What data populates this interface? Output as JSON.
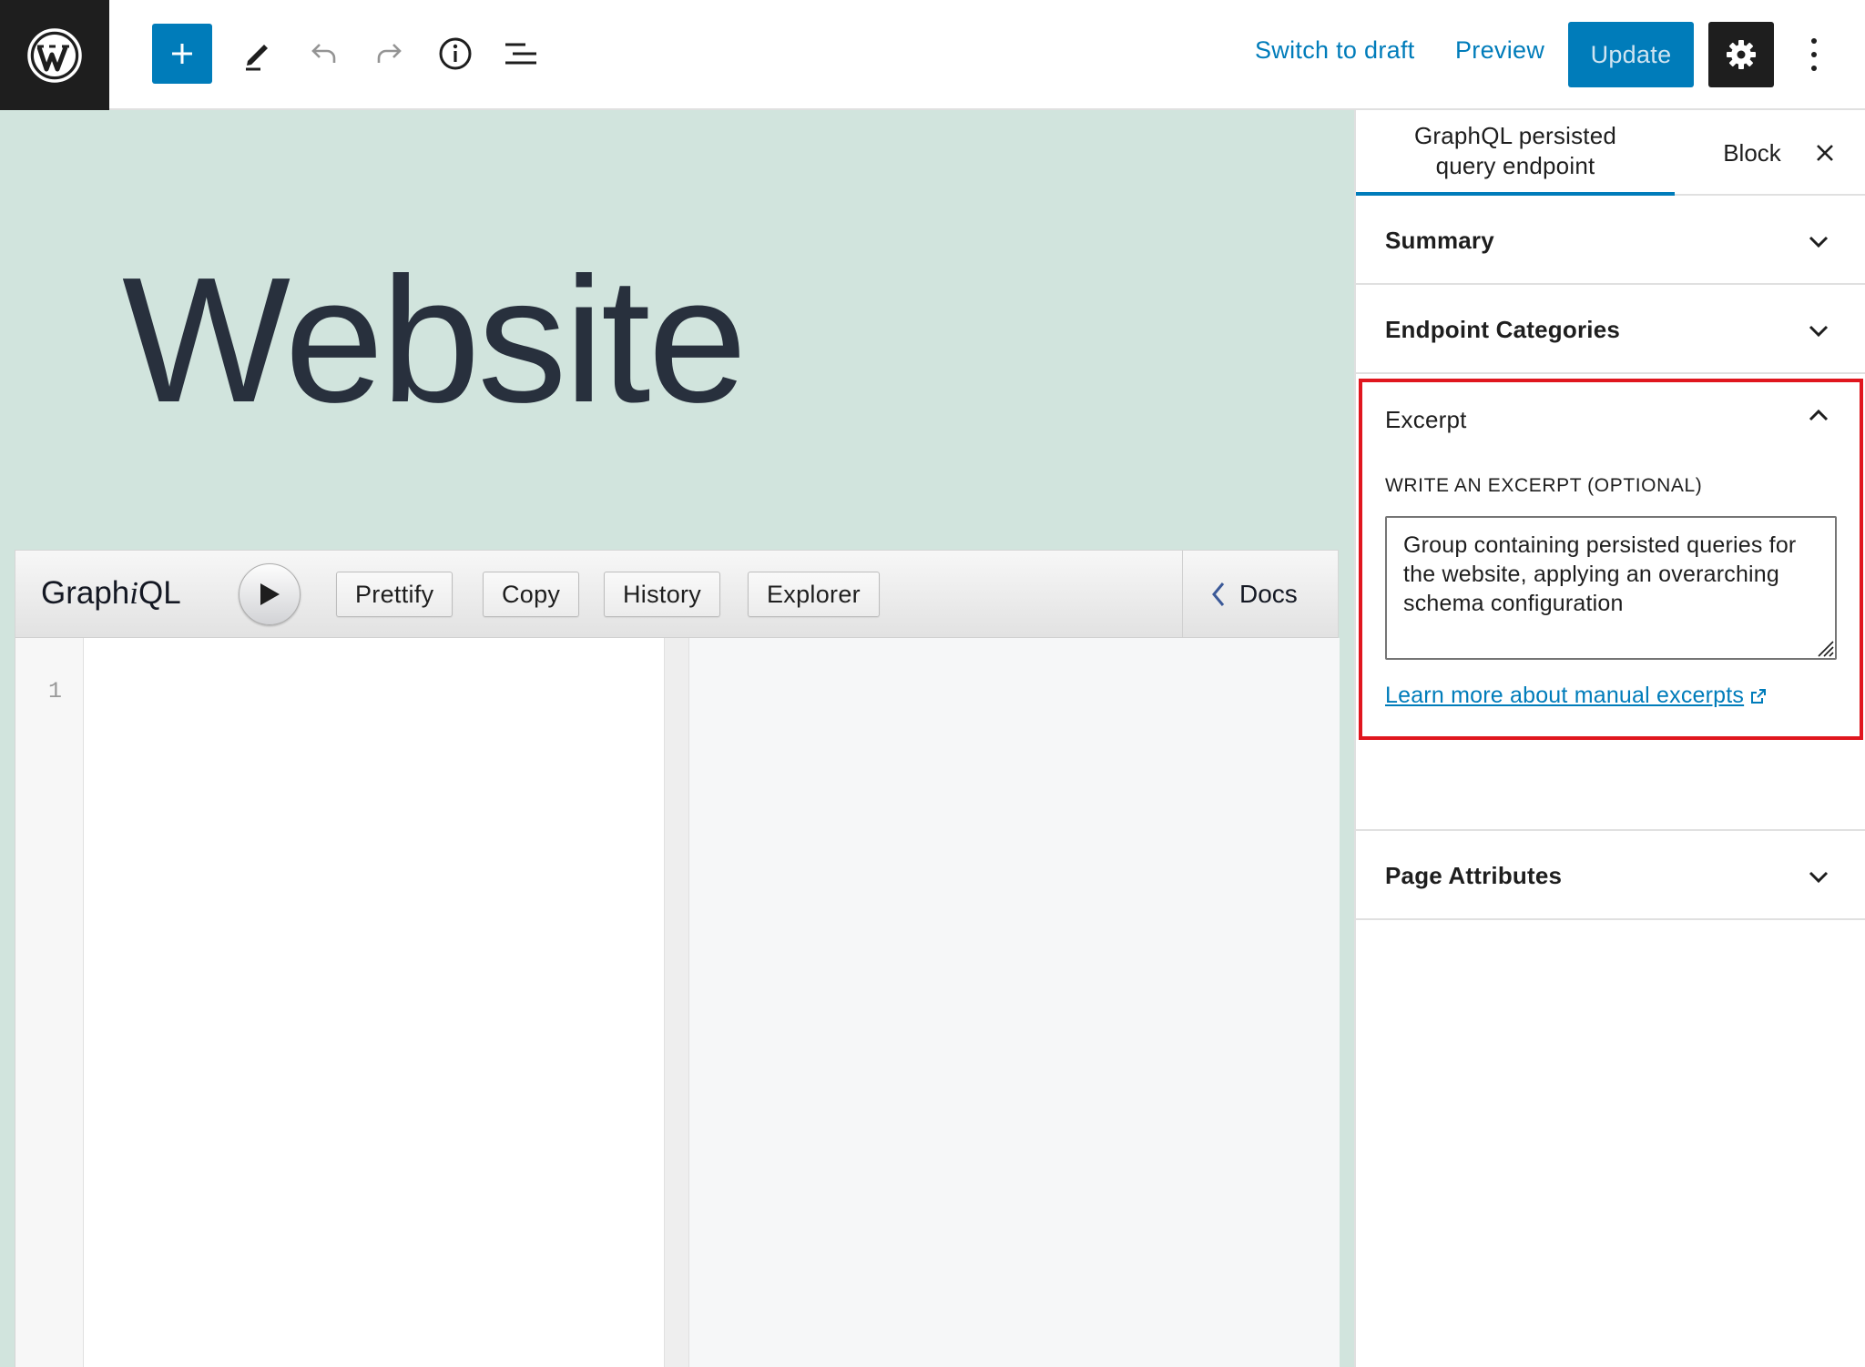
{
  "topbar": {
    "logo": "wordpress-logo",
    "icons": [
      "plus-icon",
      "pencil-icon",
      "undo-icon",
      "redo-icon",
      "info-icon",
      "list-view-icon",
      "gear-icon",
      "more-vertical-icon"
    ],
    "switch_to_draft": "Switch to draft",
    "preview": "Preview",
    "update": "Update"
  },
  "editor": {
    "title": "Website",
    "background_color": "#d1e4dd"
  },
  "graphiql": {
    "title_prefix": "Graph",
    "title_italic": "i",
    "title_suffix": "QL",
    "buttons": [
      "Prettify",
      "Copy",
      "History",
      "Explorer"
    ],
    "docs": "Docs",
    "line_number": "1"
  },
  "sidebar": {
    "tab_document_line1": "GraphQL persisted",
    "tab_document_line2": "query endpoint",
    "tab_block": "Block",
    "panels": {
      "summary": "Summary",
      "endpoint_categories": "Endpoint Categories",
      "excerpt": "Excerpt",
      "page_attributes": "Page Attributes"
    },
    "excerpt": {
      "label": "WRITE AN EXCERPT (OPTIONAL)",
      "value": "Group containing persisted queries for the website, applying an overarching schema configuration",
      "link": "Learn more about manual excerpts",
      "highlight_color": "#e0161e"
    }
  },
  "colors": {
    "accent": "#007cba",
    "dark": "#1e1e1e"
  }
}
